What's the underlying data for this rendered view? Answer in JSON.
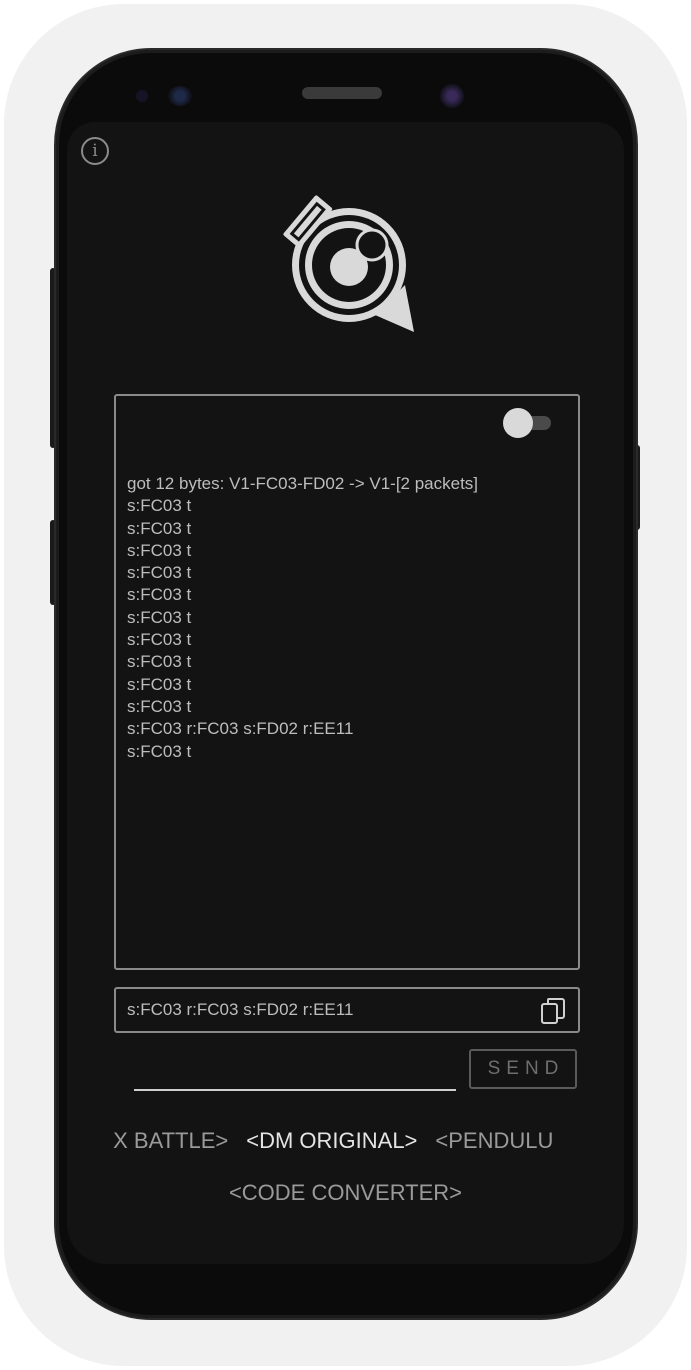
{
  "info_glyph": "i",
  "toggle": {
    "on": false
  },
  "log": {
    "lines": [
      "got 12 bytes: V1-FC03-FD02 -> V1-[2 packets]",
      "s:FC03 t",
      "s:FC03 t",
      "s:FC03 t",
      "s:FC03 t",
      "s:FC03 t",
      "s:FC03 t",
      "s:FC03 t",
      "s:FC03 t",
      "s:FC03 t",
      "s:FC03 t",
      "s:FC03 r:FC03 s:FD02 r:EE11",
      "s:FC03 t"
    ]
  },
  "input": {
    "value": "s:FC03 r:FC03 s:FD02 r:EE11"
  },
  "send": {
    "label": "SEND"
  },
  "modes": {
    "items": [
      {
        "label": "IX BATTLE>",
        "active": false
      },
      {
        "label": "<DM ORIGINAL>",
        "active": true
      },
      {
        "label": "<PENDULU",
        "active": false
      }
    ],
    "code_converter": "<CODE CONVERTER>"
  },
  "colors": {
    "screen_bg": "#131313",
    "border": "#8a8a8a",
    "text": "#bdbdbd",
    "active_text": "#e4e4e4"
  },
  "icons": [
    "info-icon",
    "app-logo-icon",
    "toggle-switch",
    "copy-icon"
  ]
}
